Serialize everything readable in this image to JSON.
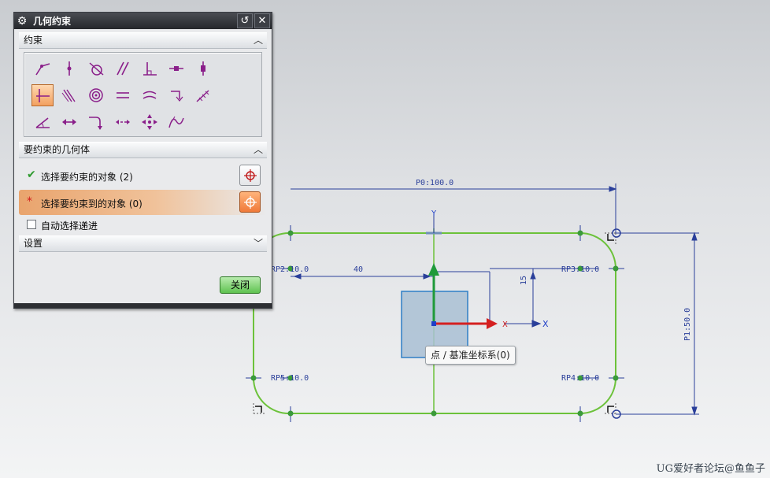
{
  "dialog": {
    "title": "几何约束",
    "reset_glyph": "↺",
    "close_glyph": "✕",
    "section_constraint": "约束",
    "section_geometry": "要约束的几何体",
    "select_object_label": "选择要约束的对象 (2)",
    "select_target_label": "选择要约束到的对象 (0)",
    "auto_select_label": "自动选择递进",
    "section_settings": "设置",
    "close_button": "关闭"
  },
  "constraint_icons": [
    "coincident-icon",
    "point-on-curve-icon",
    "tangent-icon",
    "parallel-icon",
    "perpendicular-icon",
    "horizontal-icon",
    "vertical-icon",
    "horizontal-align-icon",
    "collinear-icon",
    "concentric-icon",
    "equal-length-icon",
    "equal-radius-icon",
    "fixed-icon",
    "fully-fixed-icon",
    "constant-angle-icon",
    "constant-length-icon",
    "point-on-string-icon",
    "midpoint-icon",
    "mirror-icon",
    "slope-of-curve-icon"
  ],
  "sketch": {
    "dim_p0": "P0:100.0",
    "dim_p1": "P1:50.0",
    "dim_40": "40",
    "dim_15": "15",
    "rp2": "RP2:10.0",
    "rp3": "RP3:10.0",
    "rp4": "RP4:10.0",
    "rp5": "RP5:10.0",
    "axis_x": "X",
    "axis_x2": "X",
    "axis_y": "Y"
  },
  "tooltip": "点 / 基准坐标系(0)",
  "watermark": "UG爱好者论坛@鱼鱼子",
  "colors": {
    "sketch_curve": "#6cc23a",
    "dimension": "#2a3f9a",
    "accent_orange": "#f07a3a",
    "axis_red": "#d42020",
    "axis_green": "#1f9a3a",
    "axis_blue": "#1f3fc8"
  }
}
